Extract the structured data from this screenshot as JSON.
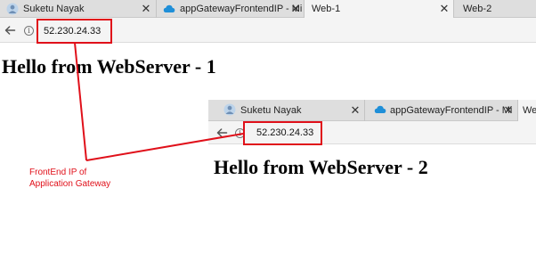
{
  "browser1": {
    "tabs": [
      {
        "label": "Suketu Nayak",
        "icon": "user-avatar-icon",
        "close": "✕"
      },
      {
        "label": "appGatewayFrontendIP - Mi",
        "icon": "azure-cloud-icon",
        "close": "✕"
      },
      {
        "label": "Web-1",
        "close": "✕"
      },
      {
        "label": "Web-2"
      }
    ],
    "url": "52.230.24.33",
    "heading": "Hello from WebServer - 1"
  },
  "browser2": {
    "tabs": [
      {
        "label": "Suketu Nayak",
        "icon": "user-avatar-icon",
        "close": "✕"
      },
      {
        "label": "appGatewayFrontendIP - Mi",
        "icon": "azure-cloud-icon",
        "close": "✕"
      },
      {
        "label": "We"
      }
    ],
    "url": "52.230.24.33",
    "heading": "Hello from WebServer - 2"
  },
  "annotation": {
    "line1": "FrontEnd IP of",
    "line2": "Application Gateway",
    "color": "#e0101a"
  }
}
